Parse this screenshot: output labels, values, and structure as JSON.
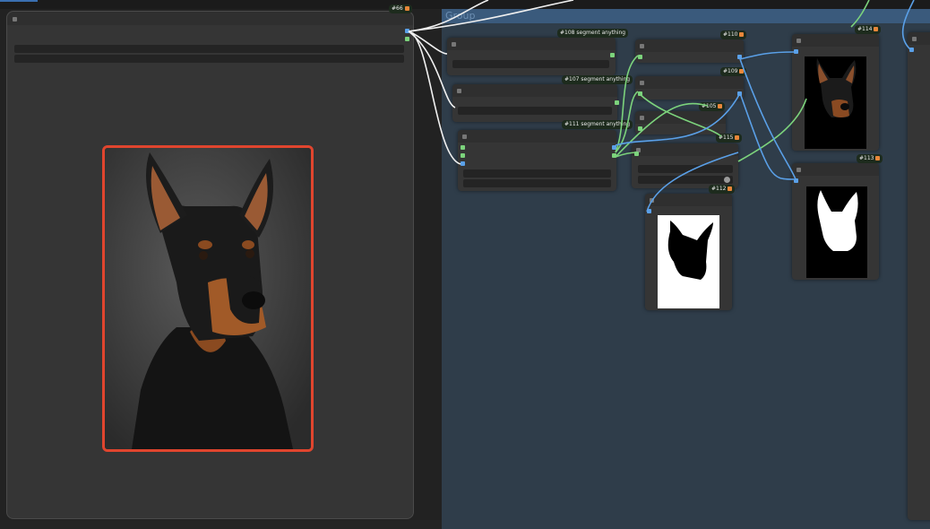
{
  "group": {
    "title": "Group"
  },
  "nodes": {
    "preview": {
      "badge": "#66"
    },
    "seg108": {
      "badge": "#108 segment anything"
    },
    "seg107": {
      "badge": "#107 segment anything"
    },
    "seg111": {
      "badge": "#111 segment anything"
    },
    "n110": {
      "badge": "#110"
    },
    "n109": {
      "badge": "#109"
    },
    "n105": {
      "badge": "#105"
    },
    "n115": {
      "badge": "#115"
    },
    "n112": {
      "badge": "#112"
    },
    "n114": {
      "badge": "#114"
    },
    "n113": {
      "badge": "#113"
    }
  },
  "images": {
    "main_preview": "doberman-portrait",
    "cutout": "doberman-cutout-on-black",
    "mask_inverted": "black-mask-on-white",
    "mask": "white-mask-on-black"
  },
  "colors": {
    "canvas": "#222222",
    "group": "#2f3d4a",
    "group_header": "#3a5a7c",
    "node": "#353535",
    "selection": "#e0452e",
    "wire_image": "#5aa0e8",
    "wire_mask": "#7cd37c",
    "wire_model": "#f0f0f0"
  }
}
